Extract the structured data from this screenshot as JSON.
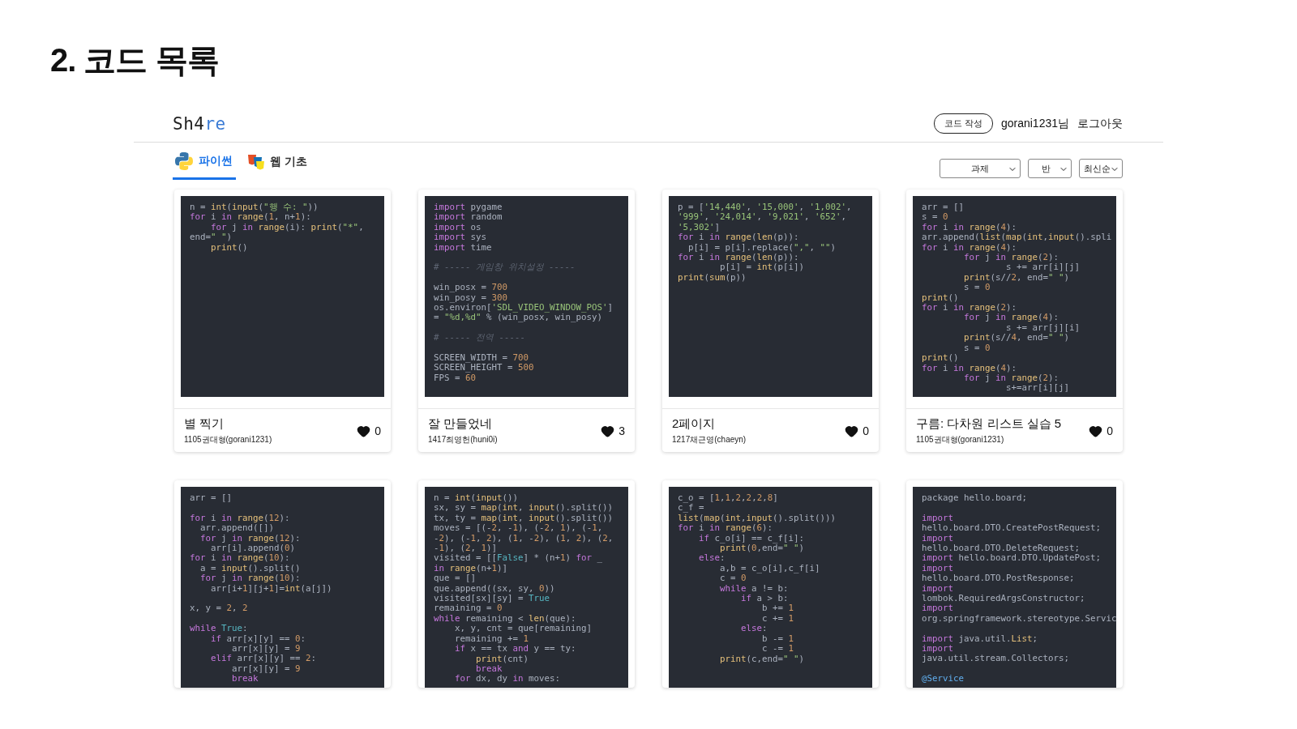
{
  "slide_title": "2. 코드 목록",
  "header": {
    "logo": {
      "text": "Sh4",
      "accent": "re"
    },
    "write_button": "코드 작성",
    "user": "gorani1231님",
    "logout": "로그아웃"
  },
  "tabs": [
    {
      "label": "파이썬",
      "selected": true
    },
    {
      "label": "웹 기초",
      "selected": false
    }
  ],
  "filters": [
    {
      "value": "과제",
      "kind": "wide"
    },
    {
      "value": "반",
      "kind": "narrow"
    },
    {
      "value": "최신순",
      "kind": "narrow"
    }
  ],
  "cards": [
    {
      "title": "별 찍기",
      "author": "1105권대형(gorani1231)",
      "likes": "0",
      "code": [
        [
          {
            "kind": "plain",
            "text": "n = "
          },
          {
            "kind": "builtin",
            "text": "int"
          },
          {
            "kind": "plain",
            "text": "("
          },
          {
            "kind": "builtin",
            "text": "input"
          },
          {
            "kind": "plain",
            "text": "("
          },
          {
            "kind": "string",
            "text": "\"행 수: \""
          },
          {
            "kind": "plain",
            "text": "))"
          }
        ],
        [
          {
            "kind": "keyword",
            "text": "for"
          },
          {
            "kind": "plain",
            "text": " i "
          },
          {
            "kind": "keyword",
            "text": "in "
          },
          {
            "kind": "builtin",
            "text": "range"
          },
          {
            "kind": "plain",
            "text": "("
          },
          {
            "kind": "number",
            "text": "1"
          },
          {
            "kind": "plain",
            "text": ", n+"
          },
          {
            "kind": "number",
            "text": "1"
          },
          {
            "kind": "plain",
            "text": "):"
          }
        ],
        [
          {
            "kind": "keyword",
            "text": "    for"
          },
          {
            "kind": "plain",
            "text": " j "
          },
          {
            "kind": "keyword",
            "text": "in "
          },
          {
            "kind": "builtin",
            "text": "range"
          },
          {
            "kind": "plain",
            "text": "(i): "
          },
          {
            "kind": "builtin",
            "text": "print"
          },
          {
            "kind": "plain",
            "text": "("
          },
          {
            "kind": "string",
            "text": "\"*\""
          },
          {
            "kind": "plain",
            "text": ","
          }
        ],
        [
          {
            "kind": "plain",
            "text": "end="
          },
          {
            "kind": "string",
            "text": "\" \""
          },
          {
            "kind": "plain",
            "text": ")"
          }
        ],
        [
          {
            "kind": "builtin",
            "text": "    print"
          },
          {
            "kind": "plain",
            "text": "()"
          }
        ]
      ]
    },
    {
      "title": "잘 만들었네",
      "author": "1417최영헌(huni0i)",
      "likes": "3",
      "code": [
        [
          {
            "kind": "keyword",
            "text": "import"
          },
          {
            "kind": "plain",
            "text": " pygame"
          }
        ],
        [
          {
            "kind": "keyword",
            "text": "import"
          },
          {
            "kind": "plain",
            "text": " random"
          }
        ],
        [
          {
            "kind": "keyword",
            "text": "import"
          },
          {
            "kind": "plain",
            "text": " os"
          }
        ],
        [
          {
            "kind": "keyword",
            "text": "import"
          },
          {
            "kind": "plain",
            "text": " sys"
          }
        ],
        [
          {
            "kind": "keyword",
            "text": "import"
          },
          {
            "kind": "plain",
            "text": " time"
          }
        ],
        [
          {
            "kind": "blank"
          }
        ],
        [
          {
            "kind": "comment",
            "text": "# ----- 게임창 위치설정 -----"
          }
        ],
        [
          {
            "kind": "blank"
          }
        ],
        [
          {
            "kind": "plain",
            "text": "win_posx = "
          },
          {
            "kind": "number",
            "text": "700"
          }
        ],
        [
          {
            "kind": "plain",
            "text": "win_posy = "
          },
          {
            "kind": "number",
            "text": "300"
          }
        ],
        [
          {
            "kind": "plain",
            "text": "os.environ["
          },
          {
            "kind": "string",
            "text": "'SDL_VIDEO_WINDOW_POS'"
          },
          {
            "kind": "plain",
            "text": "]"
          }
        ],
        [
          {
            "kind": "plain",
            "text": "= "
          },
          {
            "kind": "string",
            "text": "\"%d,%d\""
          },
          {
            "kind": "plain",
            "text": " % (win_posx, win_posy)"
          }
        ],
        [
          {
            "kind": "blank"
          }
        ],
        [
          {
            "kind": "comment",
            "text": "# ----- 전역 -----"
          }
        ],
        [
          {
            "kind": "blank"
          }
        ],
        [
          {
            "kind": "plain",
            "text": "SCREEN_WIDTH = "
          },
          {
            "kind": "number",
            "text": "700"
          }
        ],
        [
          {
            "kind": "plain",
            "text": "SCREEN_HEIGHT = "
          },
          {
            "kind": "number",
            "text": "500"
          }
        ],
        [
          {
            "kind": "plain",
            "text": "FPS = "
          },
          {
            "kind": "number",
            "text": "60"
          }
        ]
      ]
    },
    {
      "title": "2페이지",
      "author": "1217채근영(chaeyn)",
      "likes": "0",
      "code": [
        [
          {
            "kind": "plain",
            "text": "p = ["
          },
          {
            "kind": "string",
            "text": "'14,440'"
          },
          {
            "kind": "plain",
            "text": ", "
          },
          {
            "kind": "string",
            "text": "'15,000'"
          },
          {
            "kind": "plain",
            "text": ", "
          },
          {
            "kind": "string",
            "text": "'1,002'"
          },
          {
            "kind": "plain",
            "text": ","
          }
        ],
        [
          {
            "kind": "string",
            "text": "'999'"
          },
          {
            "kind": "plain",
            "text": ", "
          },
          {
            "kind": "string",
            "text": "'24,014'"
          },
          {
            "kind": "plain",
            "text": ", "
          },
          {
            "kind": "string",
            "text": "'9,021'"
          },
          {
            "kind": "plain",
            "text": ", "
          },
          {
            "kind": "string",
            "text": "'652'"
          },
          {
            "kind": "plain",
            "text": ","
          }
        ],
        [
          {
            "kind": "string",
            "text": "'5,302'"
          },
          {
            "kind": "plain",
            "text": "]"
          }
        ],
        [
          {
            "kind": "keyword",
            "text": "for"
          },
          {
            "kind": "plain",
            "text": " i "
          },
          {
            "kind": "keyword",
            "text": "in "
          },
          {
            "kind": "builtin",
            "text": "range"
          },
          {
            "kind": "plain",
            "text": "("
          },
          {
            "kind": "builtin",
            "text": "len"
          },
          {
            "kind": "plain",
            "text": "(p)):"
          }
        ],
        [
          {
            "kind": "plain",
            "text": "  p[i] = p[i].replace("
          },
          {
            "kind": "string",
            "text": "\",\""
          },
          {
            "kind": "plain",
            "text": ", "
          },
          {
            "kind": "string",
            "text": "\"\""
          },
          {
            "kind": "plain",
            "text": ")"
          }
        ],
        [
          {
            "kind": "keyword",
            "text": "for"
          },
          {
            "kind": "plain",
            "text": " i "
          },
          {
            "kind": "keyword",
            "text": "in "
          },
          {
            "kind": "builtin",
            "text": "range"
          },
          {
            "kind": "plain",
            "text": "("
          },
          {
            "kind": "builtin",
            "text": "len"
          },
          {
            "kind": "plain",
            "text": "(p)):"
          }
        ],
        [
          {
            "kind": "plain",
            "text": "        p[i] = "
          },
          {
            "kind": "builtin",
            "text": "int"
          },
          {
            "kind": "plain",
            "text": "(p[i])"
          }
        ],
        [
          {
            "kind": "builtin",
            "text": "print"
          },
          {
            "kind": "plain",
            "text": "("
          },
          {
            "kind": "builtin",
            "text": "sum"
          },
          {
            "kind": "plain",
            "text": "(p))"
          }
        ]
      ]
    },
    {
      "title": "구름: 다차원 리스트 실습 5",
      "author": "1105권대형(gorani1231)",
      "likes": "0",
      "code": [
        [
          {
            "kind": "plain",
            "text": "arr = []"
          }
        ],
        [
          {
            "kind": "plain",
            "text": "s = "
          },
          {
            "kind": "number",
            "text": "0"
          }
        ],
        [
          {
            "kind": "keyword",
            "text": "for"
          },
          {
            "kind": "plain",
            "text": " i "
          },
          {
            "kind": "keyword",
            "text": "in "
          },
          {
            "kind": "builtin",
            "text": "range"
          },
          {
            "kind": "plain",
            "text": "("
          },
          {
            "kind": "number",
            "text": "4"
          },
          {
            "kind": "plain",
            "text": "):"
          }
        ],
        [
          {
            "kind": "plain",
            "text": "arr.append("
          },
          {
            "kind": "builtin",
            "text": "list"
          },
          {
            "kind": "plain",
            "text": "("
          },
          {
            "kind": "builtin",
            "text": "map"
          },
          {
            "kind": "plain",
            "text": "("
          },
          {
            "kind": "builtin",
            "text": "int"
          },
          {
            "kind": "plain",
            "text": ","
          },
          {
            "kind": "builtin",
            "text": "input"
          },
          {
            "kind": "plain",
            "text": "().spli"
          }
        ],
        [
          {
            "kind": "keyword",
            "text": "for"
          },
          {
            "kind": "plain",
            "text": " i "
          },
          {
            "kind": "keyword",
            "text": "in "
          },
          {
            "kind": "builtin",
            "text": "range"
          },
          {
            "kind": "plain",
            "text": "("
          },
          {
            "kind": "number",
            "text": "4"
          },
          {
            "kind": "plain",
            "text": "):"
          }
        ],
        [
          {
            "kind": "keyword",
            "text": "        for"
          },
          {
            "kind": "plain",
            "text": " j "
          },
          {
            "kind": "keyword",
            "text": "in "
          },
          {
            "kind": "builtin",
            "text": "range"
          },
          {
            "kind": "plain",
            "text": "("
          },
          {
            "kind": "number",
            "text": "2"
          },
          {
            "kind": "plain",
            "text": "):"
          }
        ],
        [
          {
            "kind": "plain",
            "text": "                s += arr[i][j]"
          }
        ],
        [
          {
            "kind": "builtin",
            "text": "        print"
          },
          {
            "kind": "plain",
            "text": "(s//"
          },
          {
            "kind": "number",
            "text": "2"
          },
          {
            "kind": "plain",
            "text": ", end="
          },
          {
            "kind": "string",
            "text": "\" \""
          },
          {
            "kind": "plain",
            "text": ")"
          }
        ],
        [
          {
            "kind": "plain",
            "text": "        s = "
          },
          {
            "kind": "number",
            "text": "0"
          }
        ],
        [
          {
            "kind": "builtin",
            "text": "print"
          },
          {
            "kind": "plain",
            "text": "()"
          }
        ],
        [
          {
            "kind": "keyword",
            "text": "for"
          },
          {
            "kind": "plain",
            "text": " i "
          },
          {
            "kind": "keyword",
            "text": "in "
          },
          {
            "kind": "builtin",
            "text": "range"
          },
          {
            "kind": "plain",
            "text": "("
          },
          {
            "kind": "number",
            "text": "2"
          },
          {
            "kind": "plain",
            "text": "):"
          }
        ],
        [
          {
            "kind": "keyword",
            "text": "        for"
          },
          {
            "kind": "plain",
            "text": " j "
          },
          {
            "kind": "keyword",
            "text": "in "
          },
          {
            "kind": "builtin",
            "text": "range"
          },
          {
            "kind": "plain",
            "text": "("
          },
          {
            "kind": "number",
            "text": "4"
          },
          {
            "kind": "plain",
            "text": "):"
          }
        ],
        [
          {
            "kind": "plain",
            "text": "                s += arr[j][i]"
          }
        ],
        [
          {
            "kind": "builtin",
            "text": "        print"
          },
          {
            "kind": "plain",
            "text": "(s//"
          },
          {
            "kind": "number",
            "text": "4"
          },
          {
            "kind": "plain",
            "text": ", end="
          },
          {
            "kind": "string",
            "text": "\" \""
          },
          {
            "kind": "plain",
            "text": ")"
          }
        ],
        [
          {
            "kind": "plain",
            "text": "        s = "
          },
          {
            "kind": "number",
            "text": "0"
          }
        ],
        [
          {
            "kind": "builtin",
            "text": "print"
          },
          {
            "kind": "plain",
            "text": "()"
          }
        ],
        [
          {
            "kind": "keyword",
            "text": "for"
          },
          {
            "kind": "plain",
            "text": " i "
          },
          {
            "kind": "keyword",
            "text": "in "
          },
          {
            "kind": "builtin",
            "text": "range"
          },
          {
            "kind": "plain",
            "text": "("
          },
          {
            "kind": "number",
            "text": "4"
          },
          {
            "kind": "plain",
            "text": "):"
          }
        ],
        [
          {
            "kind": "keyword",
            "text": "        for"
          },
          {
            "kind": "plain",
            "text": " j "
          },
          {
            "kind": "keyword",
            "text": "in "
          },
          {
            "kind": "builtin",
            "text": "range"
          },
          {
            "kind": "plain",
            "text": "("
          },
          {
            "kind": "number",
            "text": "2"
          },
          {
            "kind": "plain",
            "text": "):"
          }
        ],
        [
          {
            "kind": "plain",
            "text": "                s+=arr[i][j]"
          }
        ]
      ]
    },
    {
      "code": [
        [
          {
            "kind": "plain",
            "text": "arr = []"
          }
        ],
        [
          {
            "kind": "blank"
          }
        ],
        [
          {
            "kind": "keyword",
            "text": "for"
          },
          {
            "kind": "plain",
            "text": " i "
          },
          {
            "kind": "keyword",
            "text": "in "
          },
          {
            "kind": "builtin",
            "text": "range"
          },
          {
            "kind": "plain",
            "text": "("
          },
          {
            "kind": "number",
            "text": "12"
          },
          {
            "kind": "plain",
            "text": "):"
          }
        ],
        [
          {
            "kind": "plain",
            "text": "  arr.append([])"
          }
        ],
        [
          {
            "kind": "keyword",
            "text": "  for"
          },
          {
            "kind": "plain",
            "text": " j "
          },
          {
            "kind": "keyword",
            "text": "in "
          },
          {
            "kind": "builtin",
            "text": "range"
          },
          {
            "kind": "plain",
            "text": "("
          },
          {
            "kind": "number",
            "text": "12"
          },
          {
            "kind": "plain",
            "text": "):"
          }
        ],
        [
          {
            "kind": "plain",
            "text": "    arr[i].append("
          },
          {
            "kind": "number",
            "text": "0"
          },
          {
            "kind": "plain",
            "text": ")"
          }
        ],
        [
          {
            "kind": "keyword",
            "text": "for"
          },
          {
            "kind": "plain",
            "text": " i "
          },
          {
            "kind": "keyword",
            "text": "in "
          },
          {
            "kind": "builtin",
            "text": "range"
          },
          {
            "kind": "plain",
            "text": "("
          },
          {
            "kind": "number",
            "text": "10"
          },
          {
            "kind": "plain",
            "text": "):"
          }
        ],
        [
          {
            "kind": "plain",
            "text": "  a = "
          },
          {
            "kind": "builtin",
            "text": "input"
          },
          {
            "kind": "plain",
            "text": "().split()"
          }
        ],
        [
          {
            "kind": "keyword",
            "text": "  for"
          },
          {
            "kind": "plain",
            "text": " j "
          },
          {
            "kind": "keyword",
            "text": "in "
          },
          {
            "kind": "builtin",
            "text": "range"
          },
          {
            "kind": "plain",
            "text": "("
          },
          {
            "kind": "number",
            "text": "10"
          },
          {
            "kind": "plain",
            "text": "):"
          }
        ],
        [
          {
            "kind": "plain",
            "text": "    arr[i+"
          },
          {
            "kind": "number",
            "text": "1"
          },
          {
            "kind": "plain",
            "text": "][j+"
          },
          {
            "kind": "number",
            "text": "1"
          },
          {
            "kind": "plain",
            "text": "]="
          },
          {
            "kind": "builtin",
            "text": "int"
          },
          {
            "kind": "plain",
            "text": "(a[j])"
          }
        ],
        [
          {
            "kind": "blank"
          }
        ],
        [
          {
            "kind": "plain",
            "text": "x, y = "
          },
          {
            "kind": "number",
            "text": "2"
          },
          {
            "kind": "plain",
            "text": ", "
          },
          {
            "kind": "number",
            "text": "2"
          }
        ],
        [
          {
            "kind": "blank"
          }
        ],
        [
          {
            "kind": "keyword",
            "text": "while "
          },
          {
            "kind": "constant",
            "text": "True"
          },
          {
            "kind": "plain",
            "text": ":"
          }
        ],
        [
          {
            "kind": "keyword",
            "text": "    if"
          },
          {
            "kind": "plain",
            "text": " arr[x][y] == "
          },
          {
            "kind": "number",
            "text": "0"
          },
          {
            "kind": "plain",
            "text": ":"
          }
        ],
        [
          {
            "kind": "plain",
            "text": "        arr[x][y] = "
          },
          {
            "kind": "number",
            "text": "9"
          }
        ],
        [
          {
            "kind": "keyword",
            "text": "    elif"
          },
          {
            "kind": "plain",
            "text": " arr[x][y] == "
          },
          {
            "kind": "number",
            "text": "2"
          },
          {
            "kind": "plain",
            "text": ":"
          }
        ],
        [
          {
            "kind": "plain",
            "text": "        arr[x][y] = "
          },
          {
            "kind": "number",
            "text": "9"
          }
        ],
        [
          {
            "kind": "keyword",
            "text": "        break"
          }
        ]
      ]
    },
    {
      "code": [
        [
          {
            "kind": "plain",
            "text": "n = "
          },
          {
            "kind": "builtin",
            "text": "int"
          },
          {
            "kind": "plain",
            "text": "("
          },
          {
            "kind": "builtin",
            "text": "input"
          },
          {
            "kind": "plain",
            "text": "())"
          }
        ],
        [
          {
            "kind": "plain",
            "text": "sx, sy = "
          },
          {
            "kind": "builtin",
            "text": "map"
          },
          {
            "kind": "plain",
            "text": "("
          },
          {
            "kind": "builtin",
            "text": "int"
          },
          {
            "kind": "plain",
            "text": ", "
          },
          {
            "kind": "builtin",
            "text": "input"
          },
          {
            "kind": "plain",
            "text": "().split())"
          }
        ],
        [
          {
            "kind": "plain",
            "text": "tx, ty = "
          },
          {
            "kind": "builtin",
            "text": "map"
          },
          {
            "kind": "plain",
            "text": "("
          },
          {
            "kind": "builtin",
            "text": "int"
          },
          {
            "kind": "plain",
            "text": ", "
          },
          {
            "kind": "builtin",
            "text": "input"
          },
          {
            "kind": "plain",
            "text": "().split())"
          }
        ],
        [
          {
            "kind": "plain",
            "text": "moves = [(-"
          },
          {
            "kind": "number",
            "text": "2"
          },
          {
            "kind": "plain",
            "text": ", -"
          },
          {
            "kind": "number",
            "text": "1"
          },
          {
            "kind": "plain",
            "text": "), (-"
          },
          {
            "kind": "number",
            "text": "2"
          },
          {
            "kind": "plain",
            "text": ", "
          },
          {
            "kind": "number",
            "text": "1"
          },
          {
            "kind": "plain",
            "text": "), (-"
          },
          {
            "kind": "number",
            "text": "1"
          },
          {
            "kind": "plain",
            "text": ","
          }
        ],
        [
          {
            "kind": "plain",
            "text": "-"
          },
          {
            "kind": "number",
            "text": "2"
          },
          {
            "kind": "plain",
            "text": "), (-"
          },
          {
            "kind": "number",
            "text": "1"
          },
          {
            "kind": "plain",
            "text": ", "
          },
          {
            "kind": "number",
            "text": "2"
          },
          {
            "kind": "plain",
            "text": "), ("
          },
          {
            "kind": "number",
            "text": "1"
          },
          {
            "kind": "plain",
            "text": ", -"
          },
          {
            "kind": "number",
            "text": "2"
          },
          {
            "kind": "plain",
            "text": "), ("
          },
          {
            "kind": "number",
            "text": "1"
          },
          {
            "kind": "plain",
            "text": ", "
          },
          {
            "kind": "number",
            "text": "2"
          },
          {
            "kind": "plain",
            "text": "), ("
          },
          {
            "kind": "number",
            "text": "2"
          },
          {
            "kind": "plain",
            "text": ","
          }
        ],
        [
          {
            "kind": "plain",
            "text": "-"
          },
          {
            "kind": "number",
            "text": "1"
          },
          {
            "kind": "plain",
            "text": "), ("
          },
          {
            "kind": "number",
            "text": "2"
          },
          {
            "kind": "plain",
            "text": ", "
          },
          {
            "kind": "number",
            "text": "1"
          },
          {
            "kind": "plain",
            "text": ")]"
          }
        ],
        [
          {
            "kind": "plain",
            "text": "visited = [["
          },
          {
            "kind": "constant",
            "text": "False"
          },
          {
            "kind": "plain",
            "text": "] * (n+"
          },
          {
            "kind": "number",
            "text": "1"
          },
          {
            "kind": "plain",
            "text": ") "
          },
          {
            "kind": "keyword",
            "text": "for"
          },
          {
            "kind": "plain",
            "text": " _"
          }
        ],
        [
          {
            "kind": "keyword",
            "text": "in "
          },
          {
            "kind": "builtin",
            "text": "range"
          },
          {
            "kind": "plain",
            "text": "(n+"
          },
          {
            "kind": "number",
            "text": "1"
          },
          {
            "kind": "plain",
            "text": ")]"
          }
        ],
        [
          {
            "kind": "plain",
            "text": "que = []"
          }
        ],
        [
          {
            "kind": "plain",
            "text": "que.append((sx, sy, "
          },
          {
            "kind": "number",
            "text": "0"
          },
          {
            "kind": "plain",
            "text": "))"
          }
        ],
        [
          {
            "kind": "plain",
            "text": "visited[sx][sy] = "
          },
          {
            "kind": "constant",
            "text": "True"
          }
        ],
        [
          {
            "kind": "plain",
            "text": "remaining = "
          },
          {
            "kind": "number",
            "text": "0"
          }
        ],
        [
          {
            "kind": "keyword",
            "text": "while"
          },
          {
            "kind": "plain",
            "text": " remaining < "
          },
          {
            "kind": "builtin",
            "text": "len"
          },
          {
            "kind": "plain",
            "text": "(que):"
          }
        ],
        [
          {
            "kind": "plain",
            "text": "    x, y, cnt = que[remaining]"
          }
        ],
        [
          {
            "kind": "plain",
            "text": "    remaining += "
          },
          {
            "kind": "number",
            "text": "1"
          }
        ],
        [
          {
            "kind": "keyword",
            "text": "    if"
          },
          {
            "kind": "plain",
            "text": " x == tx "
          },
          {
            "kind": "keyword",
            "text": "and"
          },
          {
            "kind": "plain",
            "text": " y == ty:"
          }
        ],
        [
          {
            "kind": "builtin",
            "text": "        print"
          },
          {
            "kind": "plain",
            "text": "(cnt)"
          }
        ],
        [
          {
            "kind": "keyword",
            "text": "        break"
          }
        ],
        [
          {
            "kind": "keyword",
            "text": "    for"
          },
          {
            "kind": "plain",
            "text": " dx, dy "
          },
          {
            "kind": "keyword",
            "text": "in"
          },
          {
            "kind": "plain",
            "text": " moves:"
          }
        ]
      ]
    },
    {
      "code": [
        [
          {
            "kind": "plain",
            "text": "c_o = ["
          },
          {
            "kind": "number",
            "text": "1"
          },
          {
            "kind": "plain",
            "text": ","
          },
          {
            "kind": "number",
            "text": "1"
          },
          {
            "kind": "plain",
            "text": ","
          },
          {
            "kind": "number",
            "text": "2"
          },
          {
            "kind": "plain",
            "text": ","
          },
          {
            "kind": "number",
            "text": "2"
          },
          {
            "kind": "plain",
            "text": ","
          },
          {
            "kind": "number",
            "text": "2"
          },
          {
            "kind": "plain",
            "text": ","
          },
          {
            "kind": "number",
            "text": "8"
          },
          {
            "kind": "plain",
            "text": "]"
          }
        ],
        [
          {
            "kind": "plain",
            "text": "c_f ="
          }
        ],
        [
          {
            "kind": "builtin",
            "text": "list"
          },
          {
            "kind": "plain",
            "text": "("
          },
          {
            "kind": "builtin",
            "text": "map"
          },
          {
            "kind": "plain",
            "text": "("
          },
          {
            "kind": "builtin",
            "text": "int"
          },
          {
            "kind": "plain",
            "text": ","
          },
          {
            "kind": "builtin",
            "text": "input"
          },
          {
            "kind": "plain",
            "text": "().split()))"
          }
        ],
        [
          {
            "kind": "keyword",
            "text": "for"
          },
          {
            "kind": "plain",
            "text": " i "
          },
          {
            "kind": "keyword",
            "text": "in "
          },
          {
            "kind": "builtin",
            "text": "range"
          },
          {
            "kind": "plain",
            "text": "("
          },
          {
            "kind": "number",
            "text": "6"
          },
          {
            "kind": "plain",
            "text": "):"
          }
        ],
        [
          {
            "kind": "keyword",
            "text": "    if"
          },
          {
            "kind": "plain",
            "text": " c_o[i] == c_f[i]:"
          }
        ],
        [
          {
            "kind": "builtin",
            "text": "        print"
          },
          {
            "kind": "plain",
            "text": "("
          },
          {
            "kind": "number",
            "text": "0"
          },
          {
            "kind": "plain",
            "text": ",end="
          },
          {
            "kind": "string",
            "text": "\" \""
          },
          {
            "kind": "plain",
            "text": ")"
          }
        ],
        [
          {
            "kind": "keyword",
            "text": "    else"
          },
          {
            "kind": "plain",
            "text": ":"
          }
        ],
        [
          {
            "kind": "plain",
            "text": "        a,b = c_o[i],c_f[i]"
          }
        ],
        [
          {
            "kind": "plain",
            "text": "        c = "
          },
          {
            "kind": "number",
            "text": "0"
          }
        ],
        [
          {
            "kind": "keyword",
            "text": "        while"
          },
          {
            "kind": "plain",
            "text": " a != b:"
          }
        ],
        [
          {
            "kind": "keyword",
            "text": "            if"
          },
          {
            "kind": "plain",
            "text": " a > b:"
          }
        ],
        [
          {
            "kind": "plain",
            "text": "                b += "
          },
          {
            "kind": "number",
            "text": "1"
          }
        ],
        [
          {
            "kind": "plain",
            "text": "                c += "
          },
          {
            "kind": "number",
            "text": "1"
          }
        ],
        [
          {
            "kind": "keyword",
            "text": "            else"
          },
          {
            "kind": "plain",
            "text": ":"
          }
        ],
        [
          {
            "kind": "plain",
            "text": "                b -= "
          },
          {
            "kind": "number",
            "text": "1"
          }
        ],
        [
          {
            "kind": "plain",
            "text": "                c -= "
          },
          {
            "kind": "number",
            "text": "1"
          }
        ],
        [
          {
            "kind": "builtin",
            "text": "        print"
          },
          {
            "kind": "plain",
            "text": "(c,end="
          },
          {
            "kind": "string",
            "text": "\" \""
          },
          {
            "kind": "plain",
            "text": ")"
          }
        ]
      ]
    },
    {
      "code": [
        [
          {
            "kind": "plain",
            "text": "package hello.board;"
          }
        ],
        [
          {
            "kind": "blank"
          }
        ],
        [
          {
            "kind": "keyword",
            "text": "import"
          }
        ],
        [
          {
            "kind": "plain",
            "text": "hello.board.DTO.CreatePostRequest;"
          }
        ],
        [
          {
            "kind": "keyword",
            "text": "import"
          }
        ],
        [
          {
            "kind": "plain",
            "text": "hello.board.DTO.DeleteRequest;"
          }
        ],
        [
          {
            "kind": "keyword",
            "text": "import"
          },
          {
            "kind": "plain",
            "text": " hello.board.DTO.UpdatePost;"
          }
        ],
        [
          {
            "kind": "keyword",
            "text": "import"
          }
        ],
        [
          {
            "kind": "plain",
            "text": "hello.board.DTO.PostResponse;"
          }
        ],
        [
          {
            "kind": "keyword",
            "text": "import"
          }
        ],
        [
          {
            "kind": "plain",
            "text": "lombok.RequiredArgsConstructor;"
          }
        ],
        [
          {
            "kind": "keyword",
            "text": "import"
          }
        ],
        [
          {
            "kind": "plain",
            "text": "org.springframework.stereotype.Servic"
          }
        ],
        [
          {
            "kind": "blank"
          }
        ],
        [
          {
            "kind": "keyword",
            "text": "import"
          },
          {
            "kind": "plain",
            "text": " java.util."
          },
          {
            "kind": "builtin",
            "text": "List"
          },
          {
            "kind": "plain",
            "text": ";"
          }
        ],
        [
          {
            "kind": "keyword",
            "text": "import"
          }
        ],
        [
          {
            "kind": "plain",
            "text": "java.util.stream.Collectors;"
          }
        ],
        [
          {
            "kind": "blank"
          }
        ],
        [
          {
            "kind": "decorator",
            "text": "@Service"
          }
        ]
      ]
    }
  ]
}
